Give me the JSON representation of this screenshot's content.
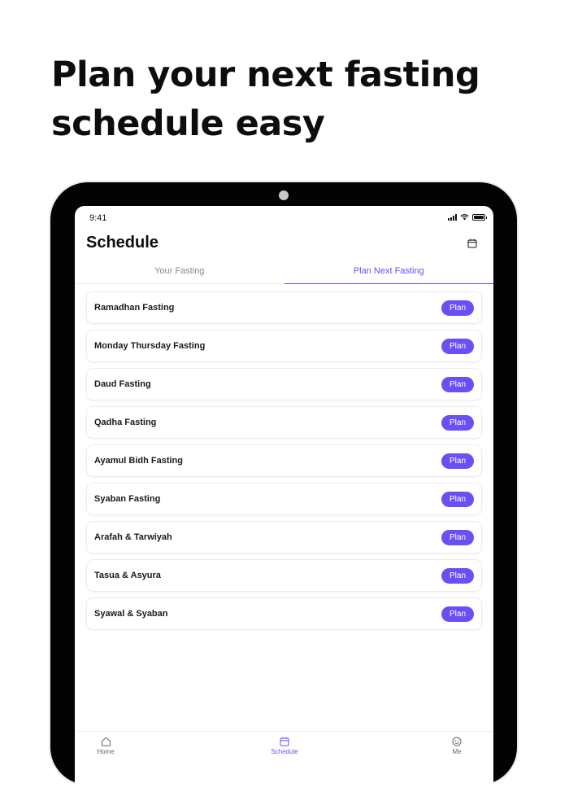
{
  "headline": {
    "line1": "Plan your next fasting",
    "line2": "schedule easy"
  },
  "status_bar": {
    "time": "9:41"
  },
  "app": {
    "title": "Schedule",
    "calendar_icon": "calendar-icon"
  },
  "tabs": [
    {
      "label": "Your Fasting",
      "active": false
    },
    {
      "label": "Plan Next Fasting",
      "active": true
    }
  ],
  "fasting_list": [
    {
      "label": "Ramadhan Fasting",
      "action": "Plan"
    },
    {
      "label": "Monday Thursday Fasting",
      "action": "Plan"
    },
    {
      "label": "Daud Fasting",
      "action": "Plan"
    },
    {
      "label": "Qadha Fasting",
      "action": "Plan"
    },
    {
      "label": "Ayamul Bidh Fasting",
      "action": "Plan"
    },
    {
      "label": "Syaban Fasting",
      "action": "Plan"
    },
    {
      "label": "Arafah & Tarwiyah",
      "action": "Plan"
    },
    {
      "label": "Tasua & Asyura",
      "action": "Plan"
    },
    {
      "label": "Syawal & Syaban",
      "action": "Plan"
    }
  ],
  "bottom_nav": [
    {
      "label": "Home",
      "icon": "home-icon",
      "active": false
    },
    {
      "label": "Schedule",
      "icon": "calendar-icon",
      "active": true
    },
    {
      "label": "Me",
      "icon": "smiley-icon",
      "active": false
    }
  ],
  "colors": {
    "accent": "#6a4ff5",
    "device_frame": "#030303",
    "text": "#111111"
  }
}
